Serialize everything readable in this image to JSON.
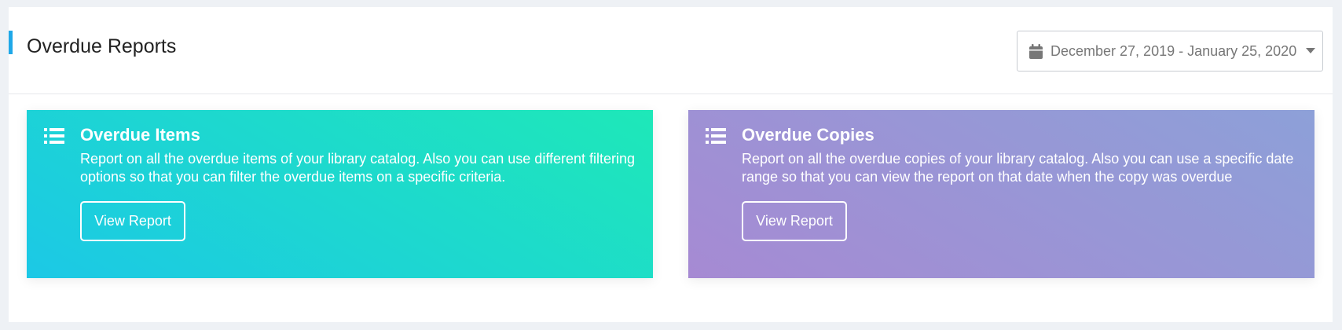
{
  "header": {
    "title": "Overdue Reports",
    "date_range": "December 27, 2019 - January 25, 2020",
    "date_icon": "calendar-icon",
    "dropdown_icon": "caret-down-icon"
  },
  "cards": [
    {
      "icon": "list-icon",
      "title": "Overdue Items",
      "description": "Report on all the overdue items of your library catalog. Also you can use different filtering options so that you can filter the overdue items on a specific criteria.",
      "button": "View Report",
      "gradient": [
        "#1cc8e6",
        "#1ee8b8"
      ]
    },
    {
      "icon": "list-icon",
      "title": "Overdue Copies",
      "description": "Report on all the overdue copies of your library catalog. Also you can use a specific date range so that you can view the report on that date when the copy was overdue",
      "button": "View Report",
      "gradient": [
        "#a68ad3",
        "#8da0d8"
      ]
    }
  ],
  "colors": {
    "accent": "#1fa8e8",
    "page_background": "#eef1f5"
  }
}
